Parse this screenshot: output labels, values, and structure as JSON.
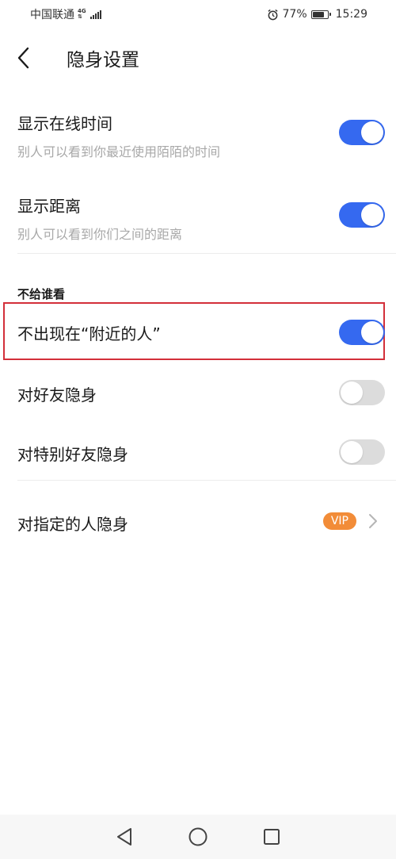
{
  "status": {
    "carrier": "中国联通",
    "network_top": "4G",
    "network_bottom": "⇅",
    "battery_percent": "77%",
    "battery_level": 0.77,
    "time": "15:29"
  },
  "header": {
    "title": "隐身设置"
  },
  "settings": [
    {
      "label": "显示在线时间",
      "description": "别人可以看到你最近使用陌陌的时间",
      "enabled": true
    },
    {
      "label": "显示距离",
      "description": "别人可以看到你们之间的距离",
      "enabled": true
    }
  ],
  "hide_from": {
    "section_title": "不给谁看",
    "items": [
      {
        "label": "不出现在“附近的人”",
        "enabled": true
      },
      {
        "label": "对好友隐身",
        "enabled": false
      },
      {
        "label": "对特别好友隐身",
        "enabled": false
      }
    ]
  },
  "specified": {
    "label": "对指定的人隐身",
    "badge": "VIP"
  },
  "colors": {
    "toggle_on": "#3569f0",
    "toggle_off": "#dcdcdc",
    "highlight": "#d32f3a",
    "vip": "#f28c38"
  },
  "icons": {
    "back": "chevron-left-icon",
    "alarm": "alarm-icon",
    "battery": "battery-icon",
    "signal": "signal-icon",
    "chevron": "chevron-right-icon",
    "nav_back": "triangle-back-icon",
    "nav_home": "circle-home-icon",
    "nav_recent": "square-recent-icon"
  }
}
